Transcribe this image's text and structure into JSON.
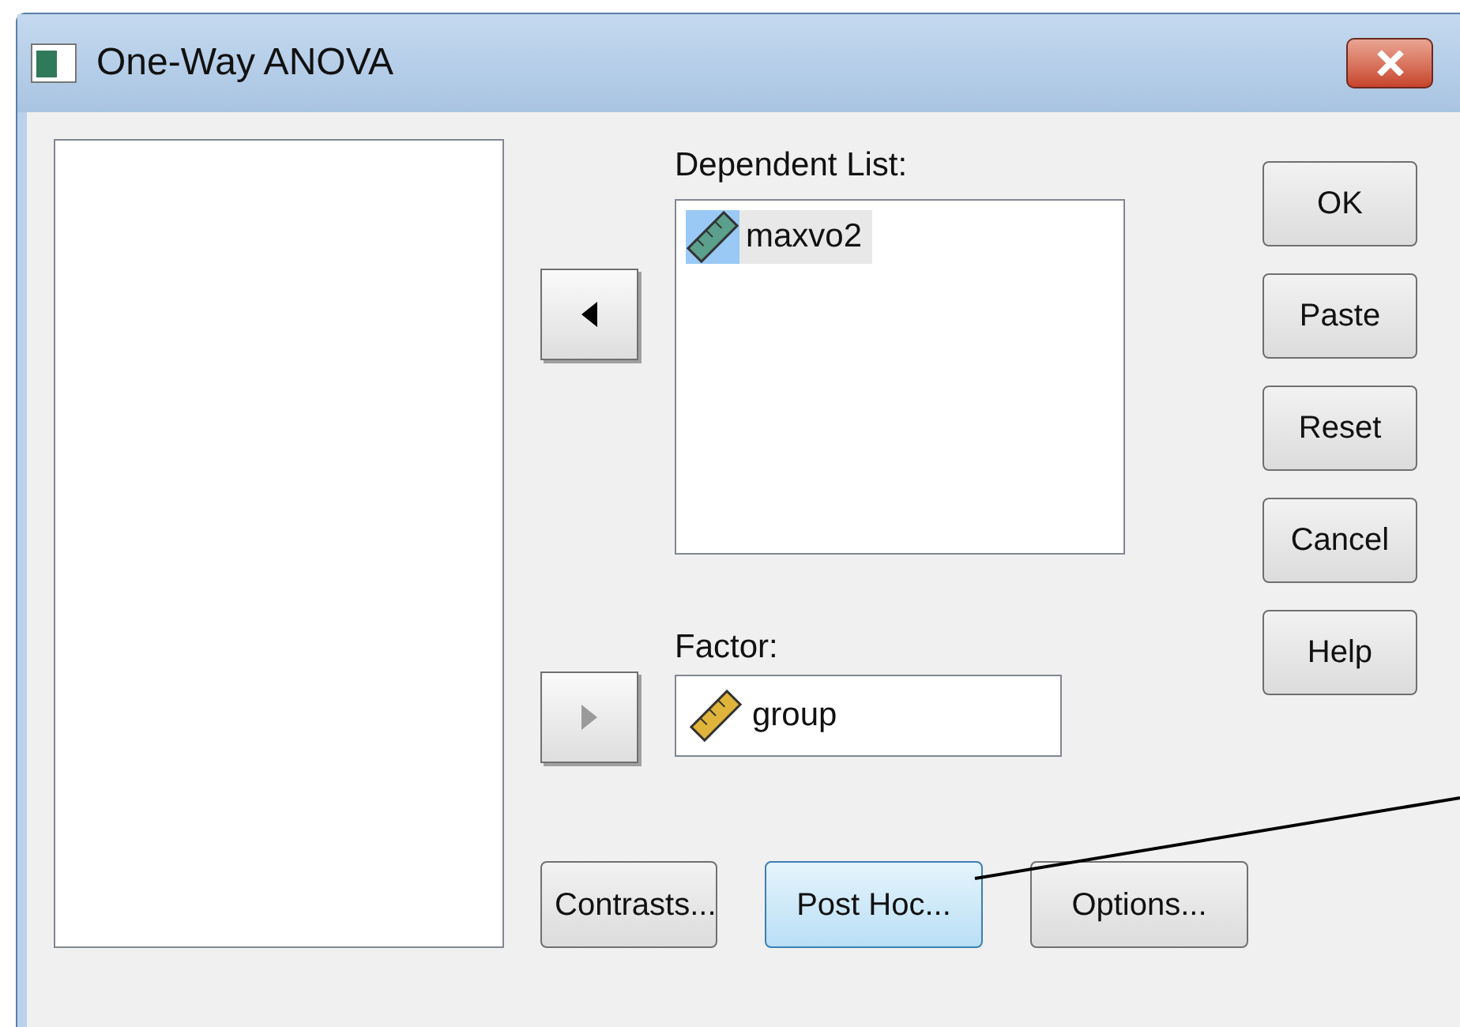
{
  "window": {
    "title": "One-Way ANOVA"
  },
  "move_buttons": [
    {
      "kind": "left",
      "disabled": false
    },
    {
      "kind": "right",
      "disabled": true
    }
  ],
  "dependent_list": {
    "label": "Dependent List:",
    "items": [
      {
        "name": "maxvo2",
        "selected": true
      }
    ]
  },
  "factor": {
    "label": "Factor:",
    "value": "group"
  },
  "side_buttons": [
    "OK",
    "Paste",
    "Reset",
    "Cancel",
    "Help"
  ],
  "bottom_buttons": [
    {
      "label": "Contrasts...",
      "highlighted": false
    },
    {
      "label": "Post Hoc...",
      "highlighted": true
    },
    {
      "label": "Options...",
      "highlighted": false
    }
  ]
}
